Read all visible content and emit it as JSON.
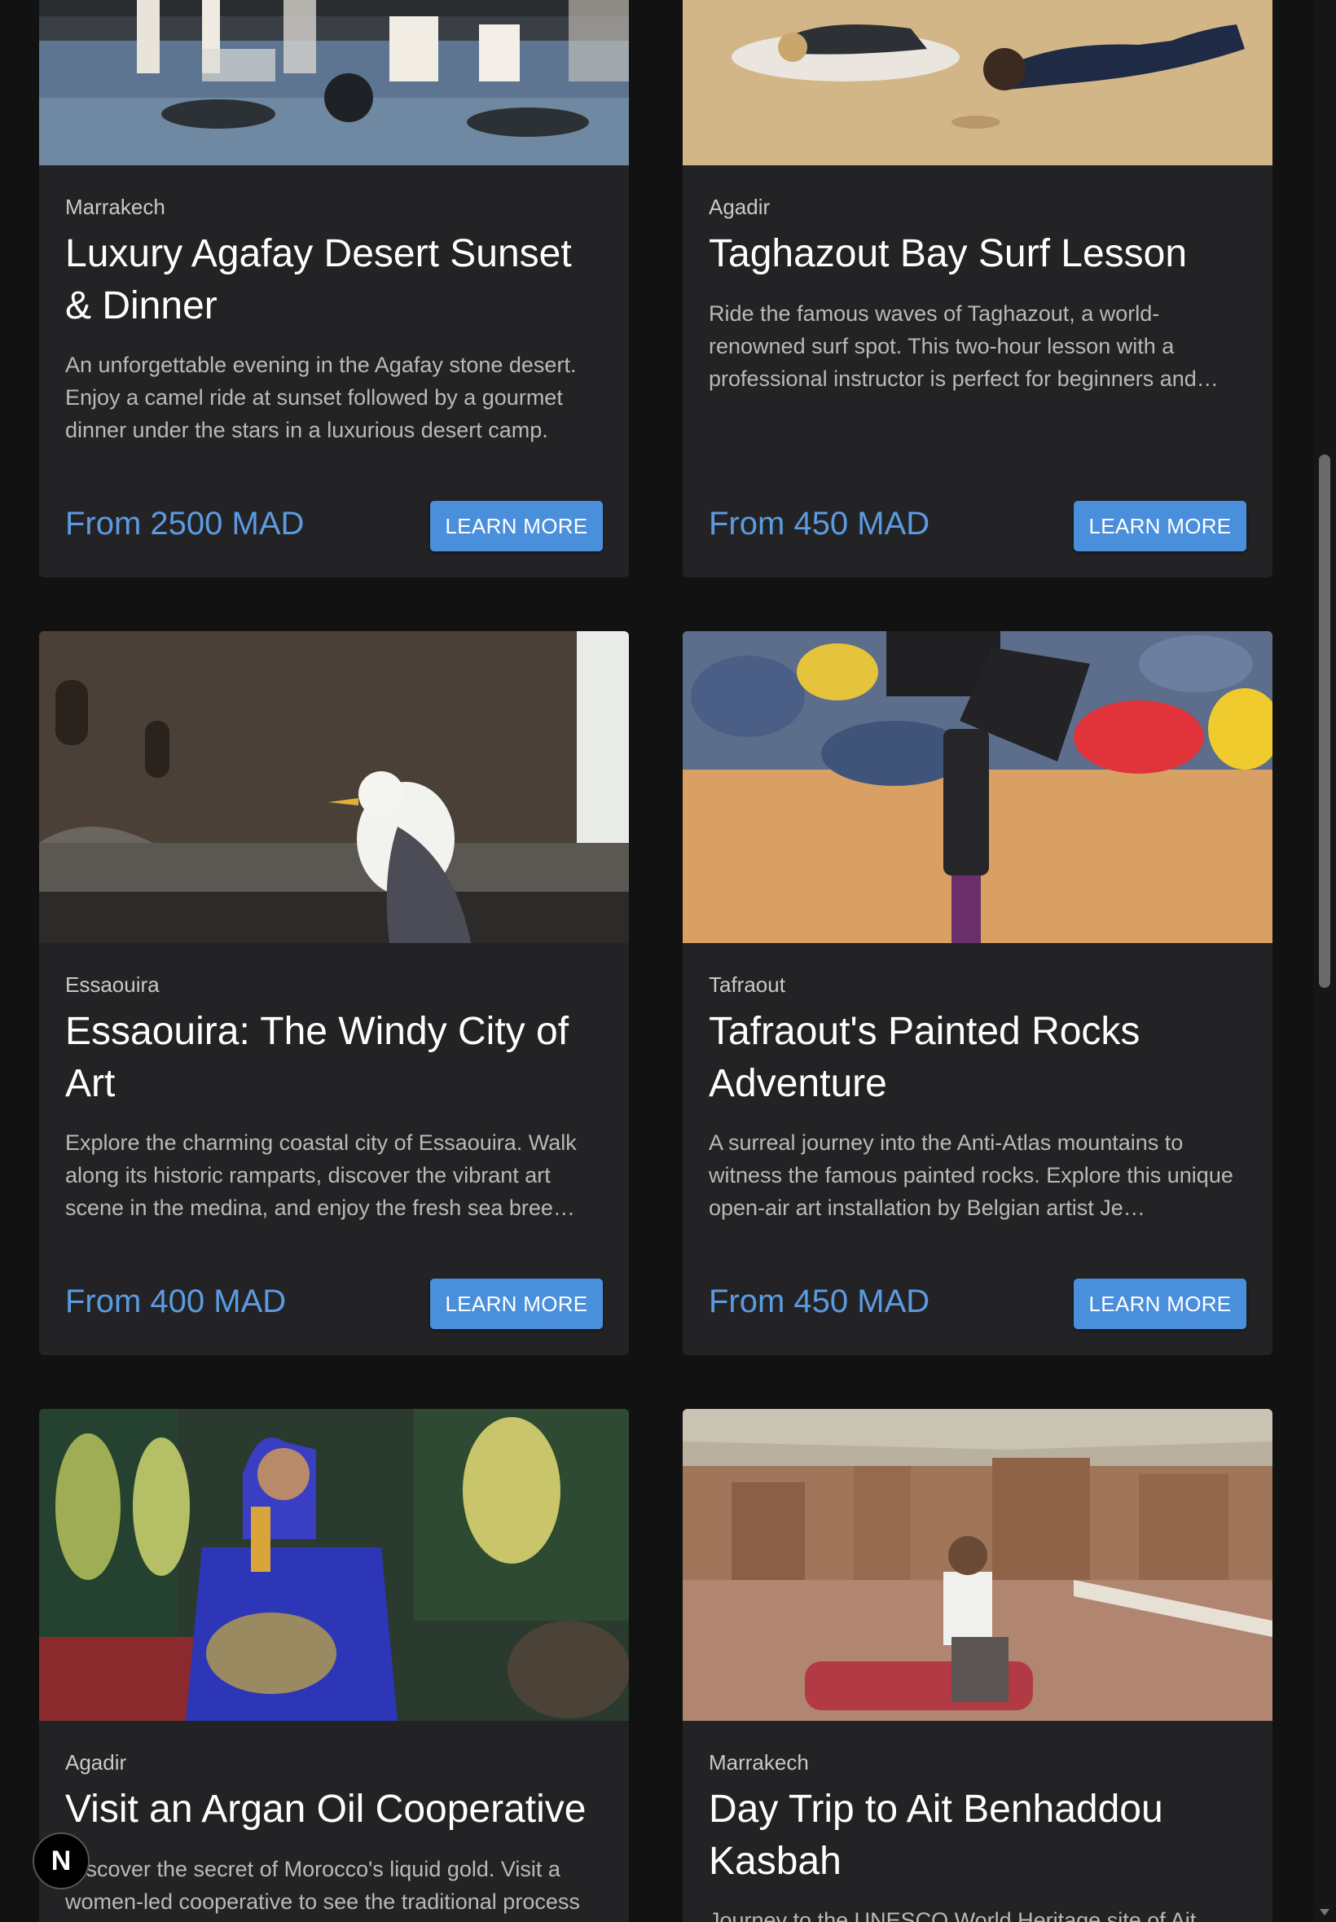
{
  "cards": [
    {
      "location": "Marrakech",
      "title": "Luxury Agafay Desert Sunset & Dinner",
      "description": "An unforgettable evening in the Agafay stone desert. Enjoy a camel ride at sunset followed by a gourmet dinner under the stars in a luxurious desert camp.",
      "price": "From 2500 MAD",
      "button": "LEARN MORE",
      "image": "desert-dinner-table-image"
    },
    {
      "location": "Agadir",
      "title": "Taghazout Bay Surf Lesson",
      "description": "Ride the famous waves of Taghazout, a world-renowned surf spot. This two-hour lesson with a professional instructor is perfect for beginners and…",
      "price": "From 450 MAD",
      "button": "LEARN MORE",
      "image": "surf-lesson-beach-image"
    },
    {
      "location": "Essaouira",
      "title": "Essaouira: The Windy City of Art",
      "description": "Explore the charming coastal city of Essaouira. Walk along its historic ramparts, discover the vibrant art scene in the medina, and enjoy the fresh sea bree…",
      "price": "From 400 MAD",
      "button": "LEARN MORE",
      "image": "seagull-ramparts-image"
    },
    {
      "location": "Tafraout",
      "title": "Tafraout's Painted Rocks Adventure",
      "description": "A surreal journey into the Anti-Atlas mountains to witness the famous painted rocks. Explore this unique open-air art installation by Belgian artist Je…",
      "price": "From 450 MAD",
      "button": "LEARN MORE",
      "image": "camera-gimbal-painted-rocks-image"
    },
    {
      "location": "Agadir",
      "title": "Visit an Argan Oil Cooperative",
      "description": "Discover the secret of Morocco's liquid gold. Visit a women-led cooperative to see the traditional process",
      "price": "",
      "button": "",
      "image": "argan-oil-woman-image"
    },
    {
      "location": "Marrakech",
      "title": "Day Trip to Ait Benhaddou Kasbah",
      "description": "Journey to the UNESCO World Heritage site of Ait",
      "price": "",
      "button": "",
      "image": "kasbah-rooftop-man-image"
    }
  ],
  "badge": {
    "letter": "N"
  },
  "colors": {
    "page_bg": "#121212",
    "card_bg": "#232325",
    "accent": "#4a8fdc",
    "price": "#5b9be0"
  }
}
